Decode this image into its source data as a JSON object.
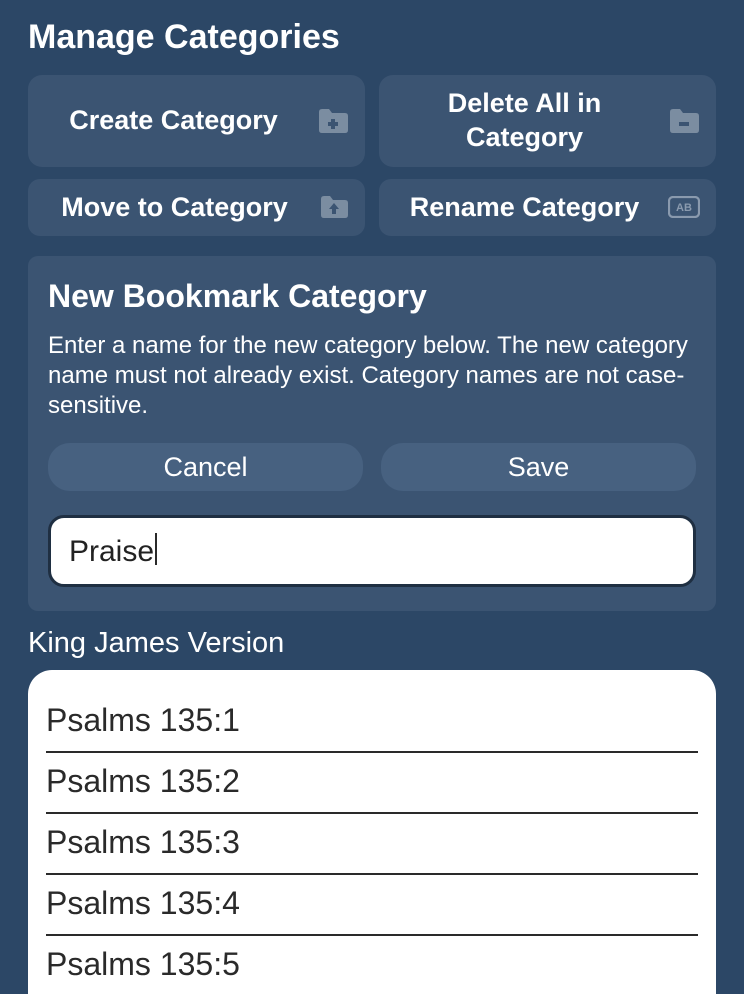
{
  "header": {
    "title": "Manage Categories"
  },
  "toolbar": {
    "create": {
      "label": "Create Category"
    },
    "deleteAll": {
      "label": "Delete All in Category"
    },
    "move": {
      "label": "Move to Category"
    },
    "rename": {
      "label": "Rename Category"
    }
  },
  "panel": {
    "title": "New Bookmark Category",
    "description": "Enter a name for the new category below. The new category name must not already exist. Category names are not case-sensitive.",
    "cancel": "Cancel",
    "save": "Save",
    "inputValue": "Praise"
  },
  "bible": {
    "version": "King James Version",
    "items": [
      "Psalms 135:1",
      "Psalms 135:2",
      "Psalms 135:3",
      "Psalms 135:4",
      "Psalms 135:5"
    ]
  }
}
